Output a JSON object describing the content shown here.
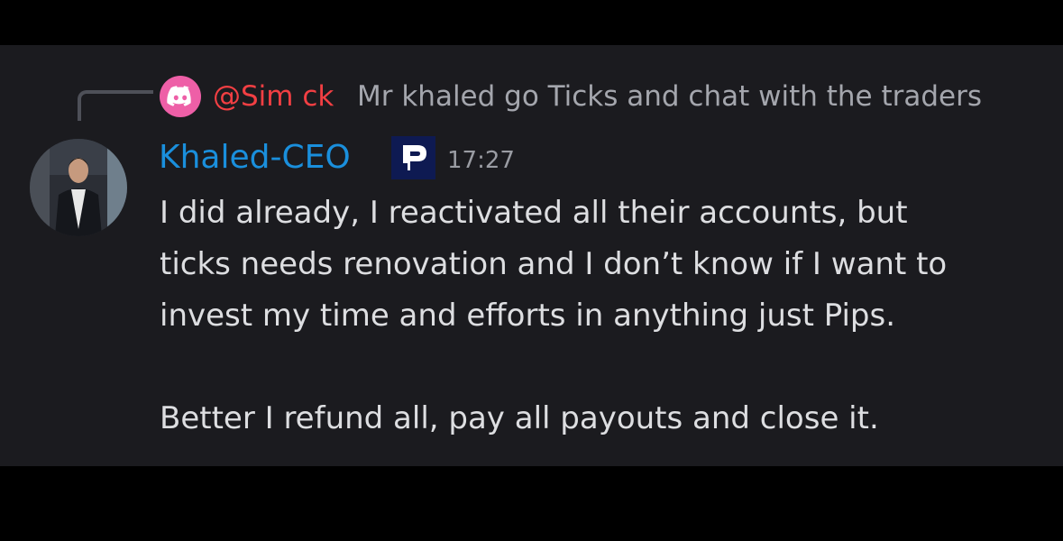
{
  "reply": {
    "author": "@Sim ck",
    "text": "Mr khaled go Ticks and chat with the traders",
    "avatar_icon": "discord-logo-icon",
    "author_color": "#f23f43"
  },
  "message": {
    "author": "Khaled-CEO",
    "author_color": "#1a8fdc",
    "role_tag_icon": "pips-logo-icon",
    "timestamp": "17:27",
    "lines": [
      "I did already, I reactivated all their accounts, but",
      "ticks needs renovation and I don’t know if I want to",
      "invest my time and efforts in anything just Pips.",
      "Better I refund all, pay all payouts and close it."
    ]
  },
  "colors": {
    "background": "#1b1b1f",
    "letterbox": "#000000",
    "reply_avatar": "#ee5fa7",
    "tag_background": "#0e1a52"
  }
}
